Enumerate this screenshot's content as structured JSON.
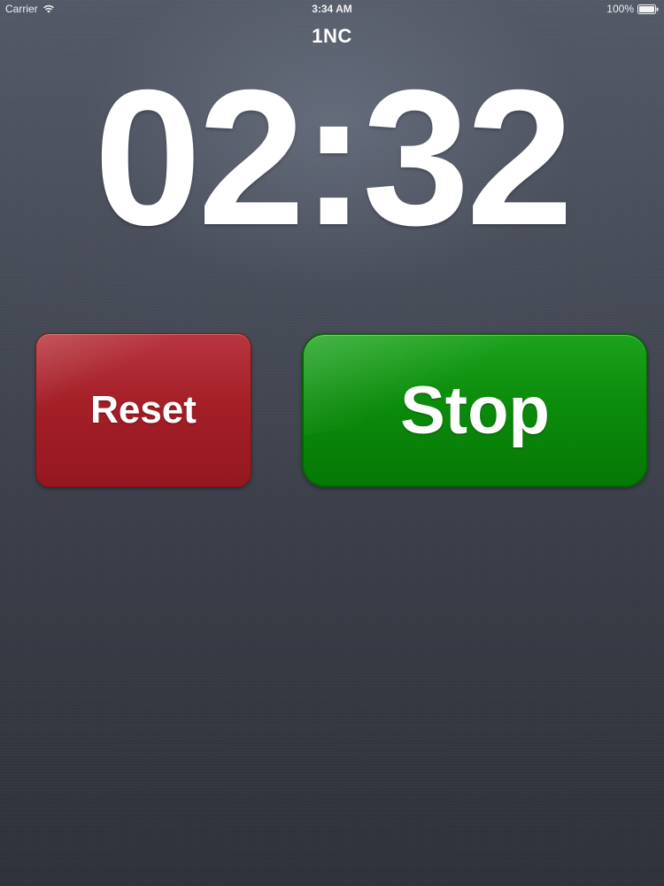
{
  "status_bar": {
    "carrier": "Carrier",
    "time": "3:34 AM",
    "battery_percent": "100%",
    "icons": {
      "wifi": "wifi-icon",
      "battery": "battery-icon"
    }
  },
  "app": {
    "title": "1NC"
  },
  "timer": {
    "display": "02:32"
  },
  "controls": {
    "reset_label": "Reset",
    "stop_label": "Stop"
  },
  "colors": {
    "reset_button": "#a51f27",
    "stop_button": "#0b8c0b",
    "background": "#444955"
  }
}
